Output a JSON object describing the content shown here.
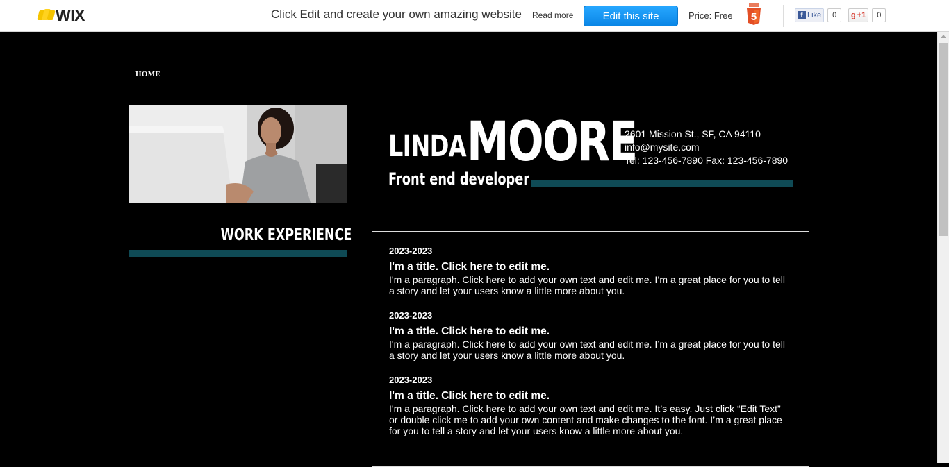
{
  "topbar": {
    "logo": "WIX",
    "promo_text": "Click Edit and create your own amazing website",
    "read_more": "Read more",
    "edit_button": "Edit this site",
    "price": "Price: Free",
    "html5_icon": "html5-icon",
    "facebook": {
      "like_label": "Like",
      "count": "0"
    },
    "gplus": {
      "label": "+1",
      "count": "0"
    }
  },
  "nav": {
    "home": "HOME"
  },
  "profile": {
    "first_name": "LINDA",
    "last_name": "MOORE",
    "role": "Front end developer",
    "address": "2601 Mission St., SF, CA  94110",
    "email": "info@mysite.com",
    "phone": "Tel: 123-456-7890 Fax: 123-456-7890"
  },
  "section": {
    "title": "WORK EXPERIENCE"
  },
  "entries": [
    {
      "date": "2023-2023",
      "title": "I'm a title. Click here to edit me.",
      "paragraph": "I'm a paragraph. Click here to add your own text and edit me. I’m a great place for you to tell a story and let your users know a little more about you."
    },
    {
      "date": "2023-2023",
      "title": "I'm a title. Click here to edit me.",
      "paragraph": "I'm a paragraph. Click here to add your own text and edit me. I’m a great place for you to tell a story and let your users know a little more about you."
    },
    {
      "date": "2023-2023",
      "title": "I'm a title. Click here to edit me.",
      "paragraph": "I'm a paragraph. Click here to add your own text and edit me. It’s easy. Just click “Edit Text” or double click me to add your own content and make changes to the font. I’m a great place for you to tell a story and let your users know a little more about you."
    }
  ],
  "colors": {
    "accent_bar": "#0f4a55",
    "edit_button": "#1a98f2",
    "background": "#000000"
  }
}
